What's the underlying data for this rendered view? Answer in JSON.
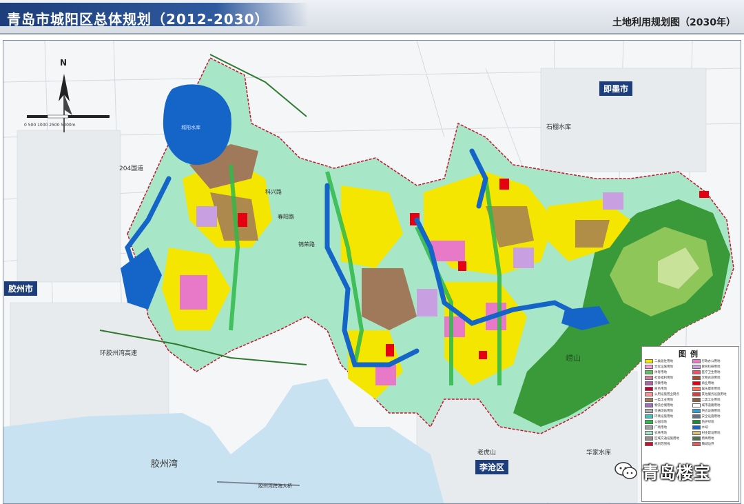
{
  "header": {
    "title": "青岛市城阳区总体规划（2012-2030）",
    "subtitle": "土地利用规划图（2030年）"
  },
  "map": {
    "compass_letter": "N",
    "scale_label": "0  500  1000  2500  5000m",
    "labels": {
      "jiaozhou_city": "胶州市",
      "jimo_city": "即墨市",
      "licang_district": "李沧区",
      "jiaozhou_bay": "胶州湾",
      "bay_bridge": "胶州湾跨海大桥",
      "ring_expressway": "环胶州湾高速",
      "road_204": "204国道",
      "laohu_mountain": "老虎山",
      "huajia_reservoir": "华家水库",
      "shifang_reservoir": "石棚水库",
      "chengyang_reservoir": "城阳水库",
      "kexing_road": "科兴路",
      "chunyang_road": "春阳路",
      "laojie_road": "崂山",
      "jinjing_road": "锦荣路"
    },
    "colors": {
      "residential": "#f5e600",
      "industrial": "#a0785a",
      "commercial": "#e60012",
      "public": "#e879c8",
      "education": "#c89fe0",
      "green": "#2fb84a",
      "water": "#1565c8",
      "mountain": "#3a9a3a",
      "mountain_high": "#8ec65a",
      "agriculture": "#a7e6c6"
    }
  },
  "legend": {
    "title": "图例",
    "items": [
      {
        "label": "二类居住用地",
        "color": "#f5e600"
      },
      {
        "label": "行政办公用地",
        "color": "#e879c8"
      },
      {
        "label": "文化设施用地",
        "color": "#f0a0d0"
      },
      {
        "label": "教育科研用地",
        "color": "#c89fe0"
      },
      {
        "label": "体育用地",
        "color": "#5fbf60"
      },
      {
        "label": "医疗卫生用地",
        "color": "#f05070"
      },
      {
        "label": "社会福利用地",
        "color": "#d080a0"
      },
      {
        "label": "文物古迹用地",
        "color": "#a0522d"
      },
      {
        "label": "宗教用地",
        "color": "#b060b0"
      },
      {
        "label": "商业用地",
        "color": "#e60012"
      },
      {
        "label": "商务用地",
        "color": "#c00030"
      },
      {
        "label": "娱乐康体用地",
        "color": "#ff7050"
      },
      {
        "label": "公用设施营业网点",
        "color": "#ff9090"
      },
      {
        "label": "其他服务设施用地",
        "color": "#d04040"
      },
      {
        "label": "一类工业用地",
        "color": "#a0785a"
      },
      {
        "label": "二类工业用地",
        "color": "#8a6040"
      },
      {
        "label": "物流仓储用地",
        "color": "#9a70c0"
      },
      {
        "label": "城市道路用地",
        "color": "#ffffff"
      },
      {
        "label": "交通场站用地",
        "color": "#b0b0b0"
      },
      {
        "label": "供应设施用地",
        "color": "#30a0d0"
      },
      {
        "label": "环境设施用地",
        "color": "#40c0c0"
      },
      {
        "label": "安全设施用地",
        "color": "#607080"
      },
      {
        "label": "公园绿地",
        "color": "#2fb84a"
      },
      {
        "label": "防护绿地",
        "color": "#1f8a35"
      },
      {
        "label": "广场用地",
        "color": "#a0a0a0"
      },
      {
        "label": "水域",
        "color": "#1565c8"
      },
      {
        "label": "农林用地",
        "color": "#a7e6c6"
      },
      {
        "label": "村庄建设用地",
        "color": "#e0c080"
      },
      {
        "label": "区域交通设施用地",
        "color": "#909090"
      },
      {
        "label": "特殊用地",
        "color": "#507050"
      },
      {
        "label": "规划范围线",
        "color": "#c8102e"
      },
      {
        "label": "镇域边界",
        "color": "#e06060"
      }
    ]
  },
  "watermark": {
    "text": "青岛楼宝"
  }
}
